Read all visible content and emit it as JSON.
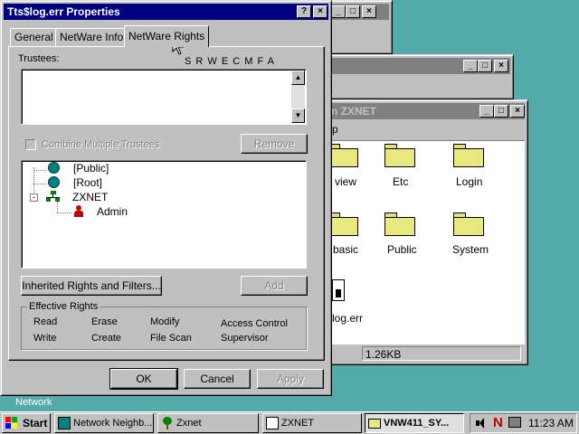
{
  "desktop": {
    "network_label": "Network"
  },
  "bg_windows": {
    "win1_buttons": [
      "_",
      "□",
      "×"
    ],
    "win2_buttons": [
      "_",
      "□",
      "×"
    ],
    "main_title_partial": "n ZXNET",
    "menu_partial": "p",
    "status_size": "1.26KB",
    "items": [
      {
        "label": "view"
      },
      {
        "label": "Etc"
      },
      {
        "label": "Login"
      },
      {
        "label": "basic"
      },
      {
        "label": "Public"
      },
      {
        "label": "System"
      },
      {
        "label": "log.err"
      }
    ]
  },
  "dialog": {
    "title": "Tts$log.err Properties",
    "title_buttons": {
      "help": "?",
      "close": "×"
    },
    "tabs": [
      {
        "label": "General"
      },
      {
        "label": "NetWare Info"
      },
      {
        "label": "NetWare Rights"
      }
    ],
    "trustees_label": "Trustees:",
    "rights_header": "S R W E C M F A",
    "combine_label": "Combine Multiple Trustees",
    "remove_label": "Remove",
    "tree": [
      {
        "label": "[Public]"
      },
      {
        "label": "[Root]"
      },
      {
        "label": "ZXNET"
      },
      {
        "label": "Admin"
      }
    ],
    "inherited_button": "Inherited Rights and Filters...",
    "add_button": "Add",
    "effective_rights": {
      "label": "Effective Rights",
      "items": [
        "Read",
        "Erase",
        "Modify",
        "Access Control",
        "Write",
        "Create",
        "File Scan",
        "Supervisor"
      ]
    },
    "ok": "OK",
    "cancel": "Cancel",
    "apply": "Apply"
  },
  "taskbar": {
    "start": "Start",
    "tasks": [
      {
        "label": "Network Neighb..."
      },
      {
        "label": "Zxnet"
      },
      {
        "label": "ZXNET"
      },
      {
        "label": "VNW411_SY..."
      }
    ],
    "tray_n": "N",
    "clock": "11:23 AM"
  },
  "colors": {
    "desktop": "#55aaaa",
    "title_active": "#000080",
    "title_inactive": "#808080"
  }
}
